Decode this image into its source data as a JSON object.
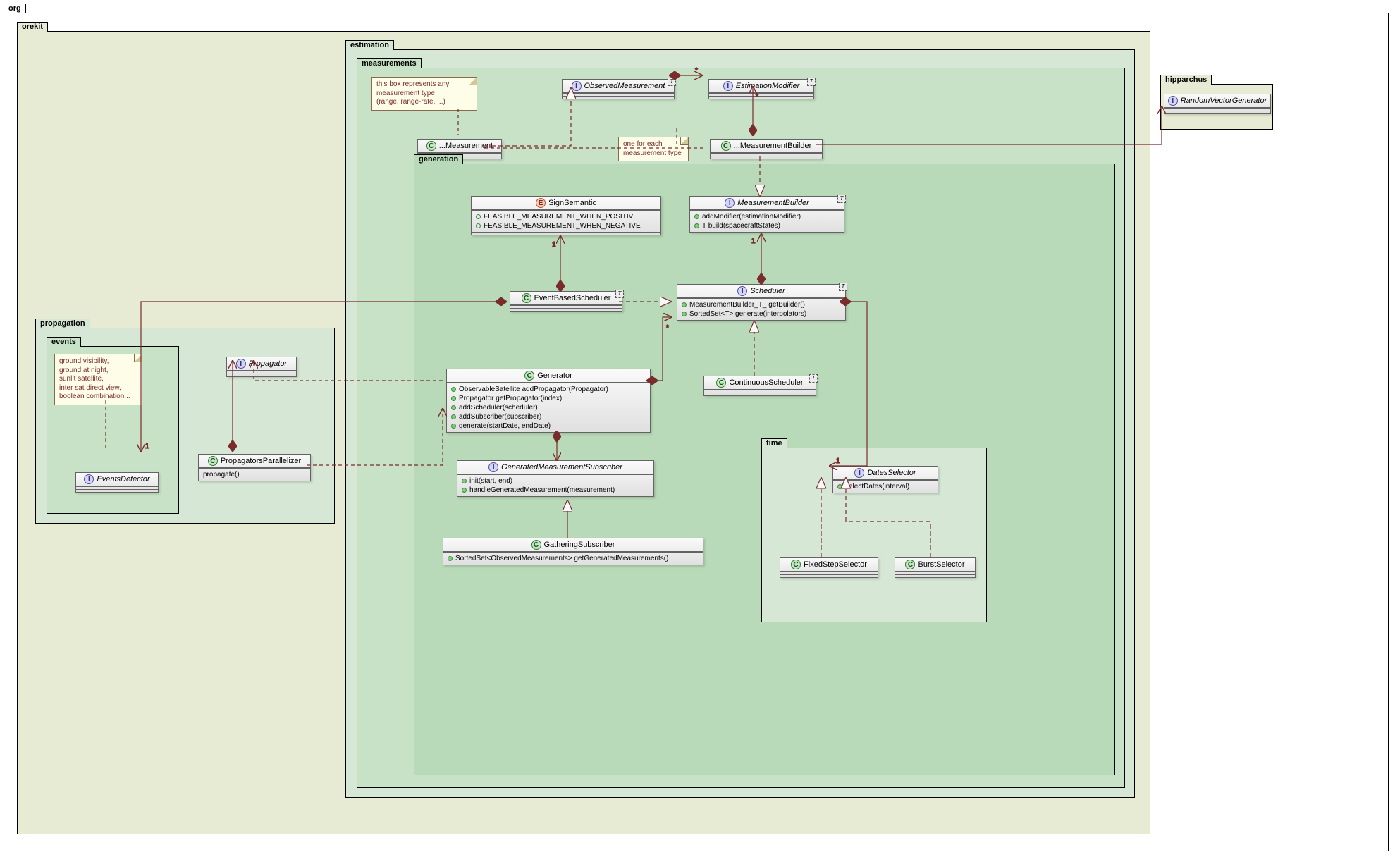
{
  "packages": {
    "org": "org",
    "orekit": "orekit",
    "hipparchus": "hipparchus",
    "estimation": "estimation",
    "measurements": "measurements",
    "generation": "generation",
    "propagation": "propagation",
    "events": "events",
    "time": "time"
  },
  "notes": {
    "measType": "this box represents any\nmeasurement type\n(range, range-rate, ...)",
    "oneEach": "one for each\nmeasurement type",
    "events": "ground visibility,\nground at night,\nsunlit satellite,\ninter sat direct view,\nboolean combination..."
  },
  "classes": {
    "ObservedMeasurement": {
      "name": "ObservedMeasurement",
      "kind": "I"
    },
    "EstimationModifier": {
      "name": "EstimationModifier",
      "kind": "I"
    },
    "Measurement": {
      "name": "...Measurement",
      "kind": "C"
    },
    "MeasBuilder": {
      "name": "...MeasurementBuilder",
      "kind": "C"
    },
    "SignSemantic": {
      "name": "SignSemantic",
      "kind": "E",
      "members": [
        "FEASIBLE_MEASUREMENT_WHEN_POSITIVE",
        "FEASIBLE_MEASUREMENT_WHEN_NEGATIVE"
      ]
    },
    "MeasurementBuilder": {
      "name": "MeasurementBuilder",
      "kind": "I",
      "members": [
        "addModifier(estimationModifier)",
        "T build(spacecraftStates)"
      ]
    },
    "EventBasedScheduler": {
      "name": "EventBasedScheduler",
      "kind": "C"
    },
    "Scheduler": {
      "name": "Scheduler",
      "kind": "I",
      "members": [
        "MeasurementBuilder_T_ getBuilder()",
        "SortedSet<T> generate(interpolators)"
      ]
    },
    "Generator": {
      "name": "Generator",
      "kind": "C",
      "members": [
        "ObservableSatellite addPropagator(Propagator)",
        "Propagator getPropagator(index)",
        "addScheduler(scheduler)",
        "addSubscriber(subscriber)",
        "generate(startDate, endDate)"
      ]
    },
    "ContinuousScheduler": {
      "name": "ContinuousScheduler",
      "kind": "C"
    },
    "GeneratedMeasurementSubscriber": {
      "name": "GeneratedMeasurementSubscriber",
      "kind": "I",
      "members": [
        "init(start, end)",
        "handleGeneratedMeasurement(measurement)"
      ]
    },
    "GatheringSubscriber": {
      "name": "GatheringSubscriber",
      "kind": "C",
      "members": [
        "SortedSet<ObservedMeasurements> getGeneratedMeasurements()"
      ]
    },
    "EventsDetector": {
      "name": "EventsDetector",
      "kind": "I"
    },
    "Propagator": {
      "name": "Propagator",
      "kind": "I"
    },
    "PropagatorsParallelizer": {
      "name": "PropagatorsParallelizer",
      "kind": "C",
      "members": [
        "propagate()"
      ]
    },
    "DatesSelector": {
      "name": "DatesSelector",
      "kind": "I",
      "members": [
        "selectDates(interval)"
      ]
    },
    "FixedStepSelector": {
      "name": "FixedStepSelector",
      "kind": "C"
    },
    "BurstSelector": {
      "name": "BurstSelector",
      "kind": "C"
    },
    "RandomVectorGenerator": {
      "name": "RandomVectorGenerator",
      "kind": "I"
    }
  },
  "mult": {
    "star": "*",
    "one": "1"
  }
}
